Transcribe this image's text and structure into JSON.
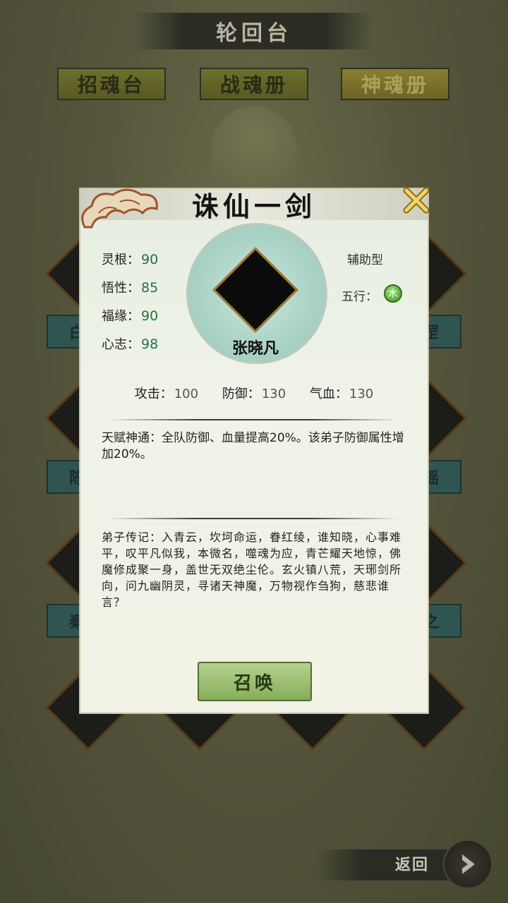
{
  "screen_title": "轮回台",
  "tabs": [
    {
      "label": "招魂台",
      "active": false
    },
    {
      "label": "战魂册",
      "active": false
    },
    {
      "label": "神魂册",
      "active": true
    }
  ],
  "background_plates": [
    "白",
    "罡",
    "陈",
    "瑶",
    "秦",
    "之"
  ],
  "modal": {
    "title": "诛仙一剑",
    "character_name": "张晓凡",
    "stats": [
      {
        "label": "灵根：",
        "value": "90"
      },
      {
        "label": "悟性：",
        "value": "85"
      },
      {
        "label": "福缘：",
        "value": "90"
      },
      {
        "label": "心志：",
        "value": "98"
      }
    ],
    "type": "辅助型",
    "element_label": "五行：",
    "element": "木",
    "combat": [
      {
        "label": "攻击：",
        "value": "100"
      },
      {
        "label": "防御：",
        "value": "130"
      },
      {
        "label": "气血：",
        "value": "130"
      }
    ],
    "talent": "天赋神通：全队防御、血量提高20%。该弟子防御属性增加20%。",
    "bio": "弟子传记：入青云，坎坷命运，眷红绫，谁知晓，心事难平，叹平凡似我，本微名，噬魂为应，青芒耀天地惊，佛魔修成聚一身，盖世无双绝尘伦。玄火镇八荒，天琊剑所向，问九幽阴灵，寻诸天神魔，万物视作刍狗，慈悲谁言？",
    "summon_label": "召唤"
  },
  "back_label": "返回",
  "colors": {
    "stat_value": "#237048",
    "element_green": "#3f9a2a",
    "accent_gold": "#a7792e"
  }
}
